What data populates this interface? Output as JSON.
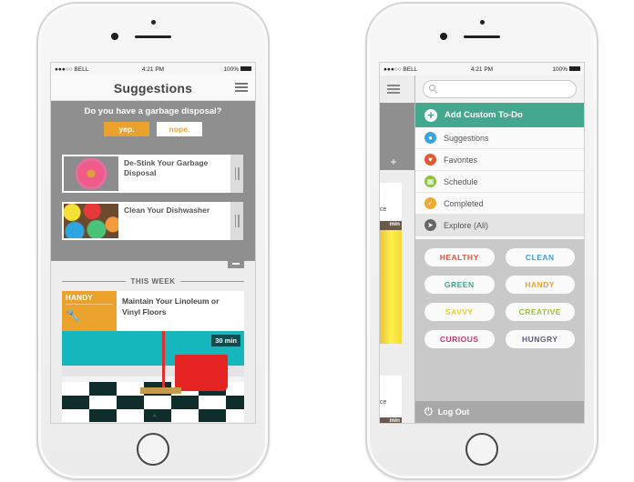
{
  "status_bar": {
    "carrier": "●●●○○ BELL",
    "wifi": "wifi-icon",
    "time": "4:21 PM",
    "bluetooth": "bluetooth-icon",
    "battery": "100%"
  },
  "left_screen": {
    "title": "Suggestions",
    "menu_icon": "hamburger-icon",
    "question": "Do you have a garbage disposal?",
    "yes_label": "yep.",
    "no_label": "nope.",
    "suggestions": [
      {
        "title": "De-Stink Your Garbage Disposal",
        "image": "pink-flower-in-drain"
      },
      {
        "title": "Clean Your Dishwasher",
        "image": "colorful-plates"
      }
    ],
    "collapse_icon": "minus-icon",
    "section_header": "THIS WEEK",
    "week_card": {
      "category": "HANDY",
      "category_icon": "wrench-icon",
      "title": "Maintain Your Linoleum or Vinyl Floors",
      "duration": "30 min",
      "image": "mop-and-bucket-on-checkered-floor"
    },
    "scroll_hint": "^"
  },
  "right_screen": {
    "behind_fragments": [
      "ce",
      "min",
      "ce",
      "min"
    ],
    "search": {
      "placeholder": "",
      "value": ""
    },
    "add_custom": "Add Custom To-Do",
    "menu_items": [
      {
        "label": "Suggestions",
        "icon": "person-icon",
        "color": "#3aa3d9"
      },
      {
        "label": "Favorites",
        "icon": "heart-icon",
        "color": "#e05a33"
      },
      {
        "label": "Schedule",
        "icon": "calendar-icon",
        "color": "#8cc43f"
      },
      {
        "label": "Completed",
        "icon": "checkmark-icon",
        "color": "#f0a92f"
      },
      {
        "label": "Explore (All)",
        "icon": "cursor-icon",
        "color": "#666666"
      }
    ],
    "tags": [
      {
        "label": "HEALTHY",
        "color": "#e0533a"
      },
      {
        "label": "CLEAN",
        "color": "#3aa3d9"
      },
      {
        "label": "GREEN",
        "color": "#3aa58d"
      },
      {
        "label": "HANDY",
        "color": "#eba22d"
      },
      {
        "label": "SAVVY",
        "color": "#e4cf2c"
      },
      {
        "label": "CREATIVE",
        "color": "#9cc43a"
      },
      {
        "label": "CURIOUS",
        "color": "#c8366a"
      },
      {
        "label": "HUNGRY",
        "color": "#5c5c7a"
      }
    ],
    "logout": "Log Out"
  },
  "colors": {
    "accent_orange": "#eba22d",
    "accent_teal": "#43a88d",
    "panel_gray": "#8f8f8f"
  }
}
